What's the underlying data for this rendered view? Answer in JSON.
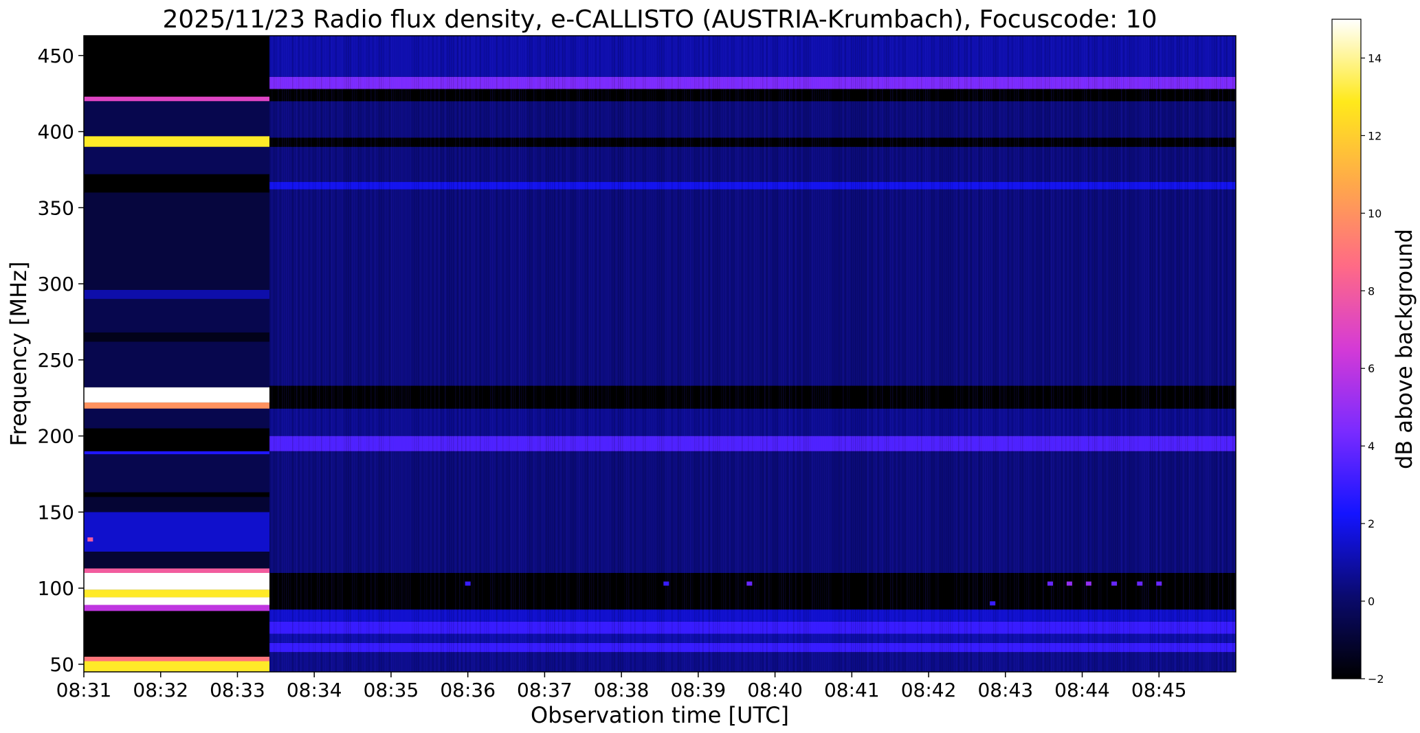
{
  "chart_data": {
    "type": "heatmap",
    "title": "2025/11/23  Radio flux density, e-CALLISTO (AUSTRIA-Krumbach), Focuscode: 10",
    "xlabel": "Observation time [UTC]",
    "ylabel": "Frequency [MHz]",
    "x_ticks": [
      "08:31",
      "08:32",
      "08:33",
      "08:34",
      "08:35",
      "08:36",
      "08:37",
      "08:38",
      "08:39",
      "08:40",
      "08:41",
      "08:42",
      "08:43",
      "08:44",
      "08:45"
    ],
    "x_range": [
      "08:31:00",
      "08:46:00"
    ],
    "y_ticks": [
      50,
      100,
      150,
      200,
      250,
      300,
      350,
      400,
      450
    ],
    "ylim": [
      45,
      463
    ],
    "colorbar": {
      "label": "dB above background",
      "ticks": [
        -2,
        0,
        2,
        4,
        6,
        8,
        10,
        12,
        14
      ],
      "range": [
        -2,
        15
      ],
      "colormap": "gnuplot2",
      "colors": [
        "#000000",
        "#0a0a6e",
        "#1414ff",
        "#7a2bff",
        "#d43ad6",
        "#ff6a86",
        "#ffa84a",
        "#ffe91b",
        "#ffffff"
      ]
    },
    "segments": [
      {
        "time_range": [
          "08:31:00",
          "08:33:25"
        ],
        "bands": [
          {
            "freq": [
              45,
              52
            ],
            "db": 13
          },
          {
            "freq": [
              52,
              55
            ],
            "db": 9
          },
          {
            "freq": [
              55,
              85
            ],
            "db": -2
          },
          {
            "freq": [
              85,
              89
            ],
            "db": 6
          },
          {
            "freq": [
              89,
              94
            ],
            "db": 15
          },
          {
            "freq": [
              94,
              99
            ],
            "db": 13
          },
          {
            "freq": [
              99,
              110
            ],
            "db": 15
          },
          {
            "freq": [
              110,
              113
            ],
            "db": 8
          },
          {
            "freq": [
              113,
              124
            ],
            "db": -1
          },
          {
            "freq": [
              124,
              150
            ],
            "db": 1.5
          },
          {
            "freq": [
              150,
              160
            ],
            "db": -1
          },
          {
            "freq": [
              160,
              163
            ],
            "db": -2
          },
          {
            "freq": [
              163,
              188
            ],
            "db": -0.5
          },
          {
            "freq": [
              188,
              190
            ],
            "db": 2.5
          },
          {
            "freq": [
              190,
              205
            ],
            "db": -2
          },
          {
            "freq": [
              205,
              218
            ],
            "db": -0.5
          },
          {
            "freq": [
              218,
              222
            ],
            "db": 10
          },
          {
            "freq": [
              222,
              232
            ],
            "db": 15
          },
          {
            "freq": [
              232,
              262
            ],
            "db": -0.5
          },
          {
            "freq": [
              262,
              268
            ],
            "db": -1.5
          },
          {
            "freq": [
              268,
              290
            ],
            "db": -0.5
          },
          {
            "freq": [
              290,
              296
            ],
            "db": 1
          },
          {
            "freq": [
              296,
              360
            ],
            "db": -0.8
          },
          {
            "freq": [
              360,
              372
            ],
            "db": -2
          },
          {
            "freq": [
              372,
              390
            ],
            "db": -0.3
          },
          {
            "freq": [
              390,
              397
            ],
            "db": 13
          },
          {
            "freq": [
              397,
              420
            ],
            "db": -0.5
          },
          {
            "freq": [
              420,
              423
            ],
            "db": 7
          },
          {
            "freq": [
              423,
              463
            ],
            "db": -2
          }
        ]
      },
      {
        "time_range": [
          "08:33:25",
          "08:46:00"
        ],
        "bands": [
          {
            "freq": [
              45,
              58
            ],
            "db": 0.5
          },
          {
            "freq": [
              58,
              64
            ],
            "db": 3
          },
          {
            "freq": [
              64,
              70
            ],
            "db": 1
          },
          {
            "freq": [
              70,
              78
            ],
            "db": 3
          },
          {
            "freq": [
              78,
              86
            ],
            "db": 1.5
          },
          {
            "freq": [
              86,
              110
            ],
            "db": -2
          },
          {
            "freq": [
              110,
              190
            ],
            "db": 0.3
          },
          {
            "freq": [
              190,
              200
            ],
            "db": 3.5
          },
          {
            "freq": [
              200,
              218
            ],
            "db": 0.6
          },
          {
            "freq": [
              218,
              233
            ],
            "db": -2
          },
          {
            "freq": [
              233,
              362
            ],
            "db": 0.3
          },
          {
            "freq": [
              362,
              367
            ],
            "db": 2
          },
          {
            "freq": [
              367,
              390
            ],
            "db": 0.3
          },
          {
            "freq": [
              390,
              396
            ],
            "db": -2
          },
          {
            "freq": [
              396,
              420
            ],
            "db": 0.3
          },
          {
            "freq": [
              420,
              428
            ],
            "db": -2
          },
          {
            "freq": [
              428,
              436
            ],
            "db": 4.5
          },
          {
            "freq": [
              436,
              463
            ],
            "db": 1
          }
        ]
      }
    ],
    "features": [
      {
        "time": "08:31:05",
        "freq": 132,
        "db": 8
      },
      {
        "time": "08:36:00",
        "freq": 103,
        "db": 3
      },
      {
        "time": "08:38:35",
        "freq": 103,
        "db": 3
      },
      {
        "time": "08:39:40",
        "freq": 103,
        "db": 4
      },
      {
        "time": "08:43:35",
        "freq": 103,
        "db": 4
      },
      {
        "time": "08:43:50",
        "freq": 103,
        "db": 5
      },
      {
        "time": "08:44:05",
        "freq": 103,
        "db": 5
      },
      {
        "time": "08:44:25",
        "freq": 103,
        "db": 4
      },
      {
        "time": "08:44:45",
        "freq": 103,
        "db": 4
      },
      {
        "time": "08:45:00",
        "freq": 103,
        "db": 4
      },
      {
        "time": "08:42:50",
        "freq": 90,
        "db": 3
      }
    ],
    "grid": false
  }
}
